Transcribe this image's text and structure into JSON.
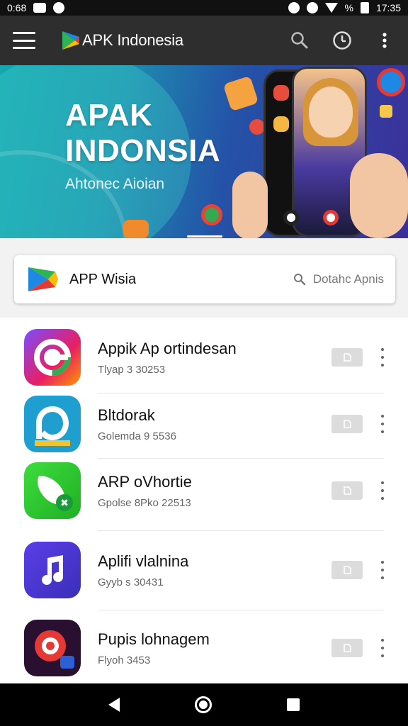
{
  "status_bar": {
    "left_text": "0:68",
    "time": "17:35",
    "battery_text": "%"
  },
  "app_bar": {
    "title": "APK Indonesia"
  },
  "banner": {
    "title_line1": "APAK",
    "title_line2": "INDONSIA",
    "subtitle": "Ahtonec Aioian"
  },
  "search": {
    "title": "APP Wisia",
    "placeholder": "Dotahc Apnis"
  },
  "apps": [
    {
      "name": "Appik Ap ortindesan",
      "meta": "Tlyap 3 30253"
    },
    {
      "name": "Bltdorak",
      "meta": "Golemda 9 5536"
    },
    {
      "name": "ARP oVhortie",
      "meta": "Gpolse 8Pko 22513"
    },
    {
      "name": "Aplifi vlalnina",
      "meta": "Gyyb s 30431"
    },
    {
      "name": "Pupis lohnagem",
      "meta": "Flyoh 3453"
    }
  ],
  "colors": {
    "appbar": "#2e2e2e",
    "banner_start": "#16a6b0",
    "banner_end": "#3c2f9a",
    "button_grey": "#dcdcdc"
  },
  "icons": [
    "menu-icon",
    "search-icon",
    "history-icon",
    "more-vert-icon",
    "play-store-icon",
    "download-icon",
    "back-icon",
    "home-icon",
    "recents-icon"
  ]
}
